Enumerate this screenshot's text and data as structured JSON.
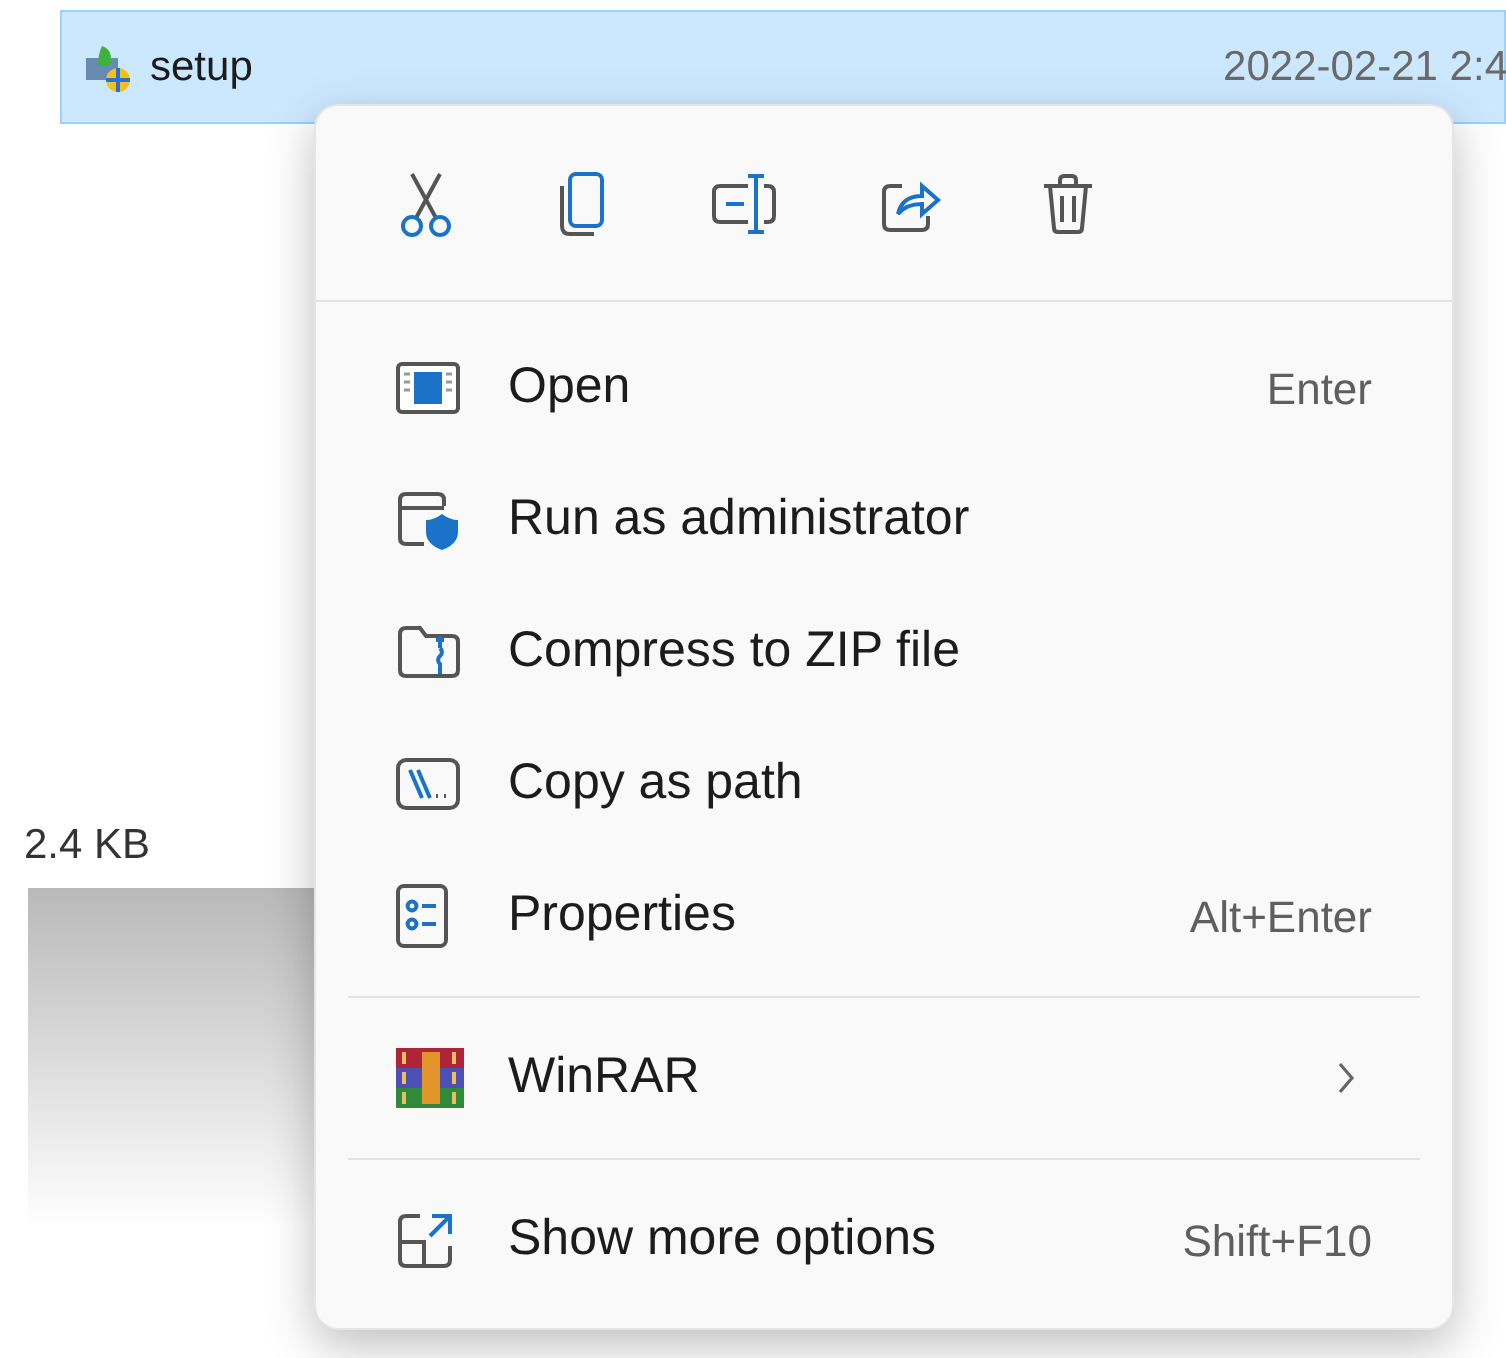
{
  "file_row": {
    "name": "setup",
    "date": "2022-02-21 2:4",
    "selected": true
  },
  "size_cell": "2.4 KB",
  "context_menu": {
    "items": [
      {
        "kind": "command",
        "label": "Open",
        "shortcut": "Enter"
      },
      {
        "kind": "command",
        "label": "Run as administrator"
      },
      {
        "kind": "command",
        "label": "Compress to ZIP file"
      },
      {
        "kind": "command",
        "label": "Copy as path"
      },
      {
        "kind": "command",
        "label": "Properties",
        "shortcut": "Alt+Enter"
      },
      {
        "kind": "separator"
      },
      {
        "kind": "submenu",
        "label": "WinRAR"
      },
      {
        "kind": "separator"
      },
      {
        "kind": "command",
        "label": "Show more options",
        "shortcut": "Shift+F10"
      }
    ]
  }
}
